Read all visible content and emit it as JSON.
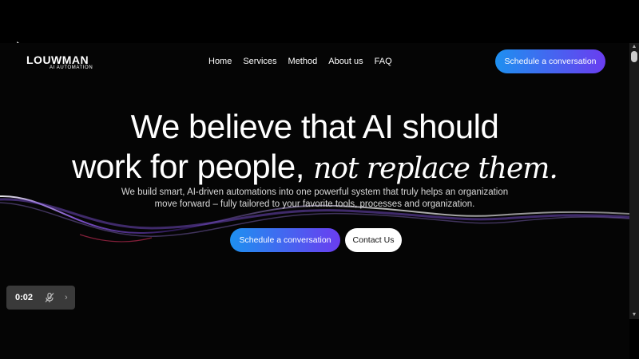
{
  "brand": {
    "name": "LOUWMAN",
    "tagline": "AI AUTOMATION"
  },
  "nav": {
    "items": [
      {
        "label": "Home"
      },
      {
        "label": "Services"
      },
      {
        "label": "Method"
      },
      {
        "label": "About us"
      },
      {
        "label": "FAQ"
      }
    ],
    "cta_label": "Schedule a conversation"
  },
  "hero": {
    "title_line1": "We believe that AI should",
    "title_line2": "work for people,",
    "title_italic": "not replace them.",
    "subtitle_line1": "We build smart, AI-driven automations into one powerful system that truly helps an organization",
    "subtitle_line2": "move forward – fully tailored to your favorite tools, processes and organization.",
    "primary_button": "Schedule a conversation",
    "secondary_button": "Contact Us"
  },
  "video_control": {
    "time": "0:02",
    "mute_icon": "mic-off-icon",
    "arrow_icon": "chevron-right-icon"
  },
  "colors": {
    "background": "#000000",
    "gradient_start": "#1e90f0",
    "gradient_end": "#6a3df0",
    "wave_purple": "#7a4fd0"
  }
}
